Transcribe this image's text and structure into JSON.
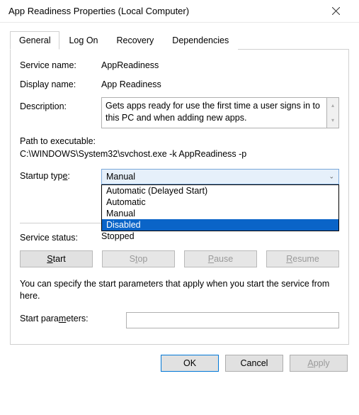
{
  "title": "App Readiness Properties (Local Computer)",
  "tabs": [
    {
      "label": "General"
    },
    {
      "label": "Log On"
    },
    {
      "label": "Recovery"
    },
    {
      "label": "Dependencies"
    }
  ],
  "labels": {
    "service_name": "Service name:",
    "display_name": "Display name:",
    "description": "Description:",
    "path_label": "Path to executable:",
    "startup_type": "Startup type:",
    "service_status": "Service status:",
    "note": "You can specify the start parameters that apply when you start the service from here.",
    "start_parameters": "Start parameters:"
  },
  "values": {
    "service_name": "AppReadiness",
    "display_name": "App Readiness",
    "description": "Gets apps ready for use the first time a user signs in to this PC and when adding new apps.",
    "path": "C:\\WINDOWS\\System32\\svchost.exe -k AppReadiness -p",
    "startup_selected": "Manual",
    "service_status": "Stopped",
    "start_parameters": ""
  },
  "startup_options": [
    "Automatic (Delayed Start)",
    "Automatic",
    "Manual",
    "Disabled"
  ],
  "svc_buttons": {
    "start": "Start",
    "stop": "Stop",
    "pause": "Pause",
    "resume": "Resume"
  },
  "footer_buttons": {
    "ok": "OK",
    "cancel": "Cancel",
    "apply": "Apply"
  }
}
